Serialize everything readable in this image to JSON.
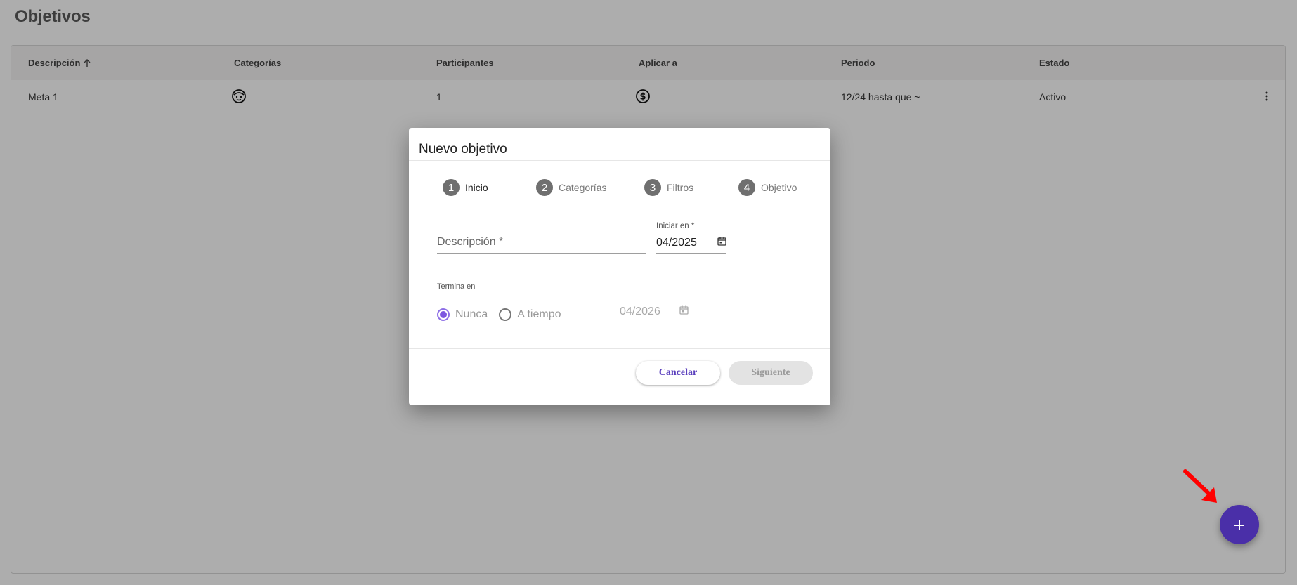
{
  "page": {
    "title": "Objetivos"
  },
  "table": {
    "columns": [
      "Descripción",
      "Categorías",
      "Participantes",
      "Aplicar a",
      "Periodo",
      "Estado"
    ],
    "sort_column": "Descripción",
    "sort_direction": "ascending",
    "rows": [
      {
        "descripcion": "Meta 1",
        "categorias_icon": "face-icon",
        "participantes": "1",
        "aplicar_icon": "dollar-circle-icon",
        "periodo": "12/24 hasta que ~",
        "estado": "Activo"
      }
    ]
  },
  "dialog": {
    "title": "Nuevo objetivo",
    "steps": [
      {
        "number": "1",
        "label": "Inicio",
        "active": true
      },
      {
        "number": "2",
        "label": "Categorías",
        "active": false
      },
      {
        "number": "3",
        "label": "Filtros",
        "active": false
      },
      {
        "number": "4",
        "label": "Objetivo",
        "active": false
      }
    ],
    "description": {
      "placeholder": "Descripción *",
      "value": ""
    },
    "start": {
      "label": "Iniciar en *",
      "value": "04/2025"
    },
    "ends": {
      "label": "Termina en",
      "options": [
        "Nunca",
        "A tiempo"
      ],
      "selected": "Nunca",
      "date_value": "04/2026"
    },
    "buttons": {
      "cancel": "Cancelar",
      "next": "Siguiente"
    }
  },
  "fab": {
    "icon": "plus-icon",
    "color": "#4a2fa8"
  },
  "colors": {
    "accent": "#7d57e0",
    "primary": "#4a2fa8",
    "annotation": "#ff0000"
  }
}
